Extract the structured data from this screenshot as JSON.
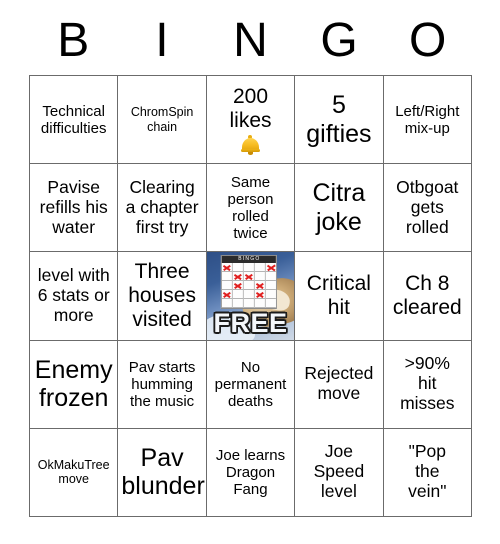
{
  "header": {
    "letters": [
      "B",
      "I",
      "N",
      "G",
      "O"
    ]
  },
  "free_space": {
    "word": "FREE",
    "mini_card_title": "BINGO",
    "marked_pattern": [
      [
        1,
        0,
        0,
        0,
        1
      ],
      [
        0,
        1,
        1,
        0,
        0
      ],
      [
        0,
        1,
        0,
        1,
        0
      ],
      [
        1,
        0,
        0,
        1,
        0
      ],
      [
        0,
        0,
        0,
        0,
        0
      ]
    ]
  },
  "colors": {
    "grid_line": "#6b6b6b",
    "cell_background": "#ffffff",
    "text": "#000000",
    "mark_red": "#e02020",
    "bell_gold": "#f5b91d"
  },
  "grid": {
    "rows": [
      [
        {
          "text": "Technical\ndifficulties",
          "size": "sm",
          "icon": null
        },
        {
          "text": "ChromSpin\nchain",
          "size": "xs",
          "icon": null
        },
        {
          "text": "200\nlikes",
          "size": "lg",
          "icon": "bell-icon"
        },
        {
          "text": "5\ngifties",
          "size": "xl",
          "icon": null
        },
        {
          "text": "Left/Right\nmix-up",
          "size": "sm",
          "icon": null
        }
      ],
      [
        {
          "text": "Pavise\nrefills his\nwater",
          "size": "md",
          "icon": null
        },
        {
          "text": "Clearing\na chapter\nfirst try",
          "size": "md",
          "icon": null
        },
        {
          "text": "Same\nperson\nrolled\ntwice",
          "size": "sm",
          "icon": null
        },
        {
          "text": "Citra\njoke",
          "size": "xl",
          "icon": null
        },
        {
          "text": "Otbgoat\ngets\nrolled",
          "size": "md",
          "icon": null
        }
      ],
      [
        {
          "text": "level with\n6 stats or\nmore",
          "size": "md",
          "icon": null
        },
        {
          "text": "Three\nhouses\nvisited",
          "size": "lg",
          "icon": null
        },
        {
          "text": "FREE",
          "size": "free",
          "icon": null
        },
        {
          "text": "Critical\nhit",
          "size": "lg",
          "icon": null
        },
        {
          "text": "Ch 8\ncleared",
          "size": "lg",
          "icon": null
        }
      ],
      [
        {
          "text": "Enemy\nfrozen",
          "size": "xl",
          "icon": null
        },
        {
          "text": "Pav starts\nhumming\nthe music",
          "size": "sm",
          "icon": null
        },
        {
          "text": "No\npermanent\ndeaths",
          "size": "sm",
          "icon": null
        },
        {
          "text": "Rejected\nmove",
          "size": "md",
          "icon": null
        },
        {
          "text": ">90%\nhit\nmisses",
          "size": "md",
          "icon": null
        }
      ],
      [
        {
          "text": "OkMakuTree\nmove",
          "size": "xs",
          "icon": null
        },
        {
          "text": "Pav\nblunder",
          "size": "xl",
          "icon": null
        },
        {
          "text": "Joe learns\nDragon\nFang",
          "size": "sm",
          "icon": null
        },
        {
          "text": "Joe\nSpeed\nlevel",
          "size": "md",
          "icon": null
        },
        {
          "text": "\"Pop\nthe\nvein\"",
          "size": "md",
          "icon": null
        }
      ]
    ]
  }
}
